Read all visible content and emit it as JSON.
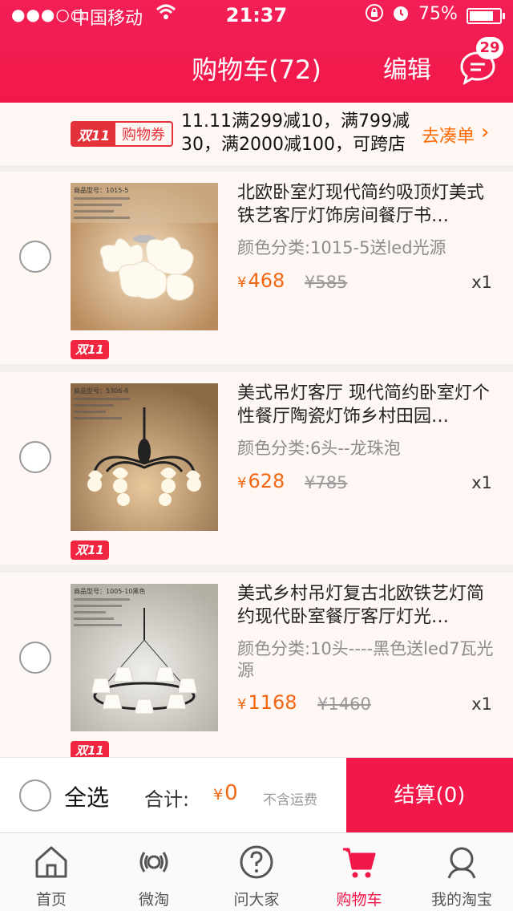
{
  "status_bar": {
    "signal": "●●●○○",
    "carrier": "中国移动",
    "time": "21:37",
    "battery": "75%",
    "battery_level": 0.75
  },
  "header": {
    "title": "购物车(72)",
    "edit_label": "编辑",
    "message_badge": "29",
    "accent_color": "#f2194a"
  },
  "coupon": {
    "tag_d11": "双11",
    "tag_label": "购物券",
    "text": "11.11满299减10，满799减30，满2000减100，可跨店",
    "link": "去凑单",
    "arrow": "›"
  },
  "items": [
    {
      "title": "北欧卧室灯现代简约吸顶灯美式铁艺客厅灯饰房间餐厅书…",
      "variant": "颜色分类:1015-5送led光源",
      "price": "468",
      "old_price": "¥585",
      "qty": "x1",
      "badge": "双11",
      "thumb_label": "商品型号：1015-5"
    },
    {
      "title": "美式吊灯客厅 现代简约卧室灯个性餐厅陶瓷灯饰乡村田园…",
      "variant": "颜色分类:6头--龙珠泡",
      "price": "628",
      "old_price": "¥785",
      "qty": "x1",
      "badge": "双11",
      "thumb_label": "商品型号：5306-6"
    },
    {
      "title": "美式乡村吊灯复古北欧铁艺灯简约现代卧室餐厅客厅灯光…",
      "variant": "颜色分类:10头----黑色送led7瓦光源",
      "price": "1168",
      "old_price": "¥1460",
      "qty": "x1",
      "badge": "双11",
      "thumb_label": "商品型号：1005-10黑色"
    }
  ],
  "currency": "¥",
  "checkout": {
    "select_all": "全选",
    "total_label": "合计:",
    "total_value": "0",
    "shipping_note": "不含运费",
    "button": "结算(0)"
  },
  "tabs": [
    {
      "label": "首页",
      "icon": "home-icon"
    },
    {
      "label": "微淘",
      "icon": "broadcast-icon"
    },
    {
      "label": "问大家",
      "icon": "question-icon"
    },
    {
      "label": "购物车",
      "icon": "cart-icon"
    },
    {
      "label": "我的淘宝",
      "icon": "profile-icon"
    }
  ]
}
